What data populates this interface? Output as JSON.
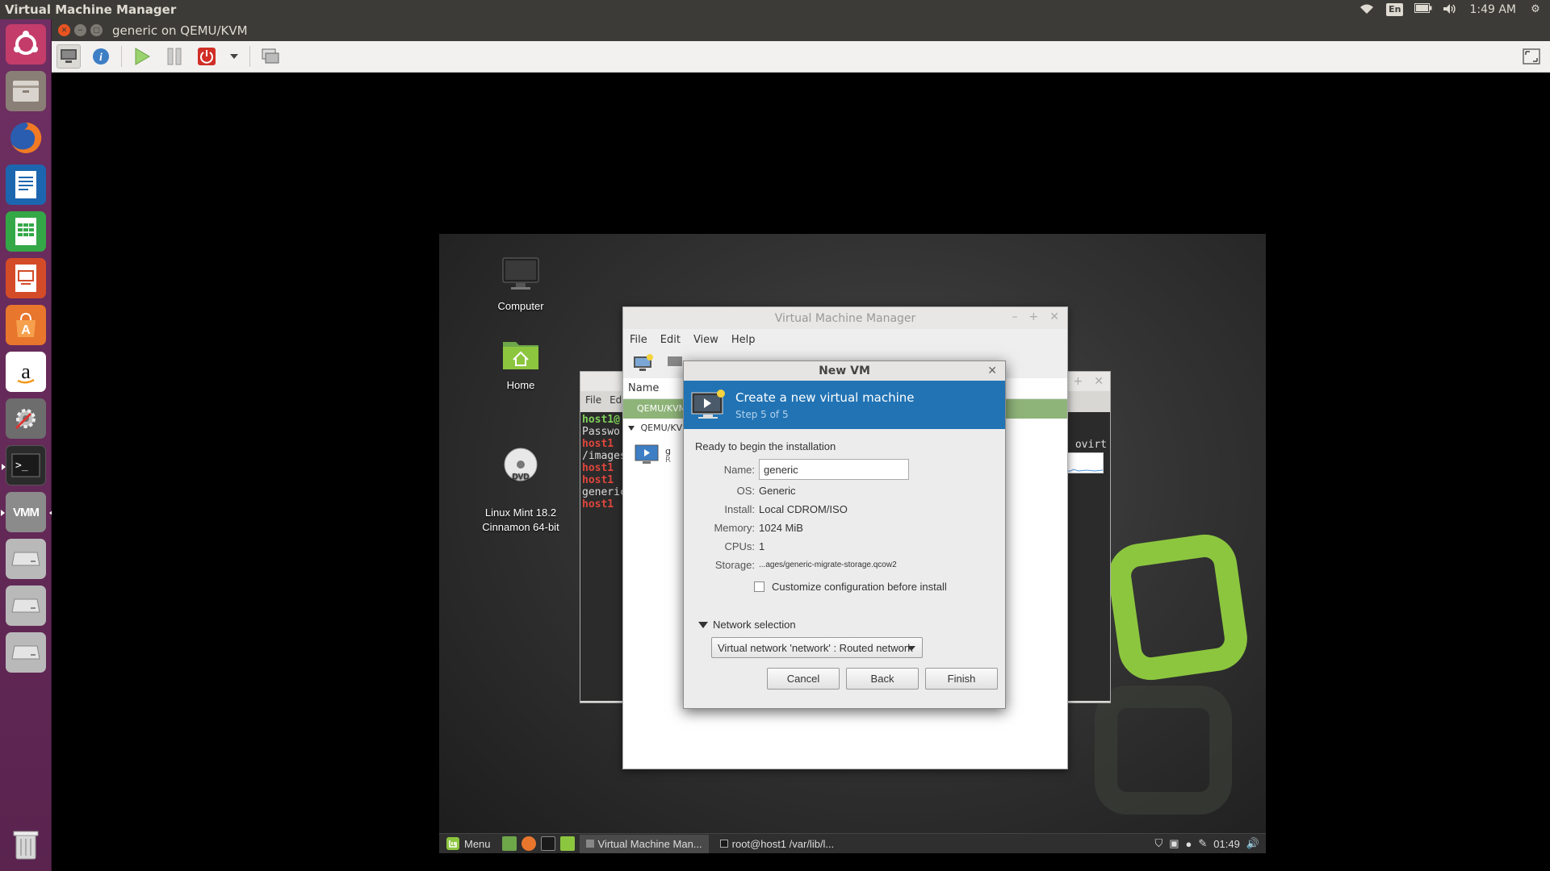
{
  "top_panel": {
    "app_title": "Virtual Machine Manager",
    "lang": "En",
    "clock": "1:49 AM"
  },
  "viewer": {
    "title": "generic on QEMU/KVM"
  },
  "launcher": {
    "items": [
      "ubuntu-logo",
      "files",
      "firefox",
      "writer",
      "calc",
      "impress",
      "software-center",
      "amazon",
      "system-settings",
      "terminal",
      "virt-manager",
      "drive-1",
      "drive-2",
      "drive-3",
      "trash"
    ]
  },
  "guest": {
    "desktop_icons": [
      {
        "label": "Computer"
      },
      {
        "label": "Home"
      },
      {
        "label": "Linux Mint 18.2\nCinnamon 64-bit"
      }
    ],
    "terminal": {
      "menu": [
        "File",
        "Ed"
      ],
      "lines": [
        {
          "text": "host1@",
          "cls": "t-bg-green"
        },
        {
          "text": "Passwo",
          "cls": ""
        },
        {
          "text": "host1 ",
          "cls": "t-red"
        },
        {
          "text": "/images",
          "cls": ""
        },
        {
          "text": "host1 ",
          "cls": "t-red"
        },
        {
          "text": "host1 ",
          "cls": "t-red"
        },
        {
          "text": "generic",
          "cls": ""
        },
        {
          "text": "host1 ",
          "cls": "t-red"
        }
      ],
      "right_text": "ovirt"
    },
    "vmm": {
      "title": "Virtual Machine Manager",
      "menu": [
        "File",
        "Edit",
        "View",
        "Help"
      ],
      "column_header": "Name",
      "connection": "QEMU/KVM",
      "connection2": "QEMU/KVM:",
      "vm_partial_1": "g",
      "vm_partial_2": "R"
    },
    "newvm": {
      "title": "New VM",
      "banner_title": "Create a new virtual machine",
      "banner_step": "Step 5 of 5",
      "ready_text": "Ready to begin the installation",
      "name_label": "Name:",
      "name_value": "generic",
      "os_label": "OS:",
      "os_value": "Generic",
      "install_label": "Install:",
      "install_value": "Local CDROM/ISO",
      "memory_label": "Memory:",
      "memory_value": "1024 MiB",
      "cpus_label": "CPUs:",
      "cpus_value": "1",
      "storage_label": "Storage:",
      "storage_value": "...ages/generic-migrate-storage.qcow2",
      "customize_label": "Customize configuration before install",
      "customize_checked": false,
      "network_section": "Network selection",
      "network_value": "Virtual network 'network' : Routed network",
      "cancel": "Cancel",
      "back": "Back",
      "finish": "Finish"
    },
    "panel": {
      "menu_label": "Menu",
      "task1": "Virtual Machine Man...",
      "task2": "root@host1 /var/lib/l...",
      "clock": "01:49"
    }
  },
  "colors": {
    "ubuntu_panel": "#3c3b37",
    "launcher": "#6f2f62",
    "banner_blue": "#2173b4",
    "mint_green": "#8cc63f",
    "close_red": "#e95420"
  }
}
